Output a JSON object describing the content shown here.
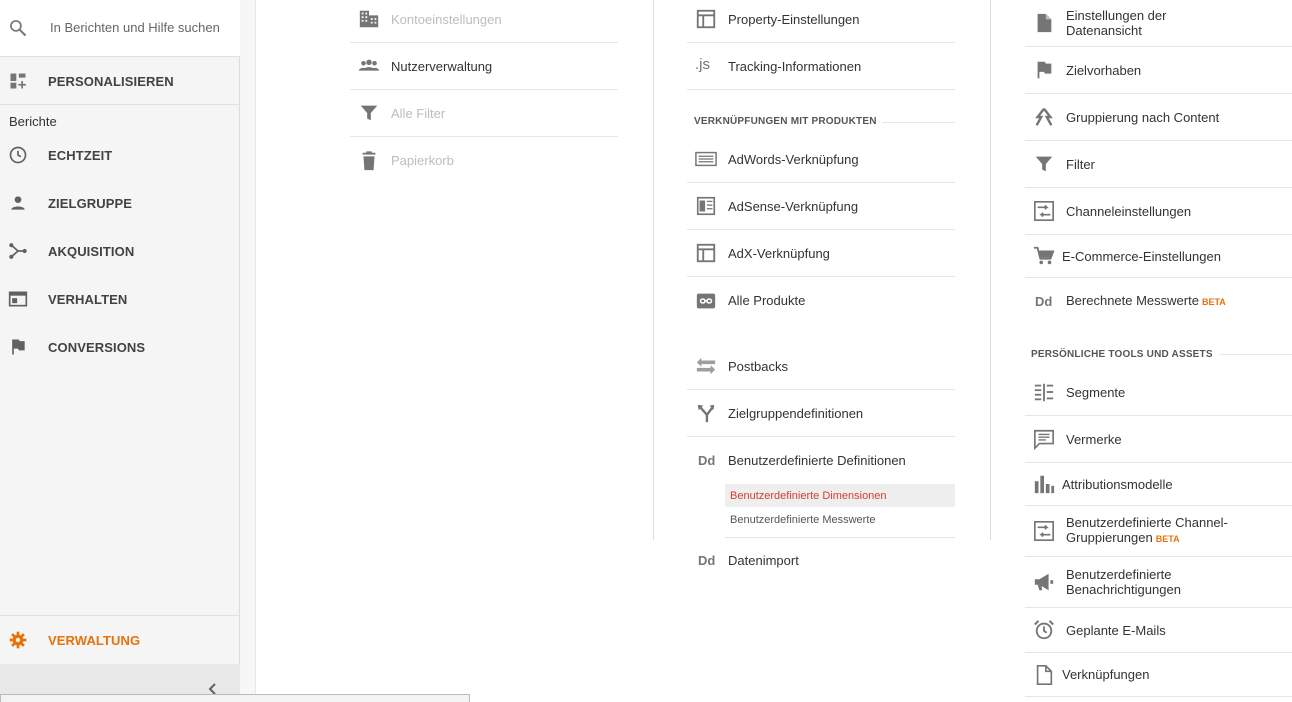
{
  "search": {
    "placeholder": "In Berichten und Hilfe suchen"
  },
  "sidebar": {
    "customize": "PERSONALISIEREN",
    "section_label": "Berichte",
    "items": [
      {
        "label": "ECHTZEIT",
        "icon": "clock-icon"
      },
      {
        "label": "ZIELGRUPPE",
        "icon": "person-icon"
      },
      {
        "label": "AKQUISITION",
        "icon": "acquisition-icon"
      },
      {
        "label": "VERHALTEN",
        "icon": "behavior-icon"
      },
      {
        "label": "CONVERSIONS",
        "icon": "flag-icon"
      }
    ],
    "admin": "VERWALTUNG",
    "accent_color": "#e8710a"
  },
  "account_column": {
    "items": [
      {
        "label": "Kontoeinstellungen",
        "icon": "building-icon",
        "disabled": true
      },
      {
        "label": "Nutzerverwaltung",
        "icon": "users-icon",
        "disabled": false
      },
      {
        "label": "Alle Filter",
        "icon": "filter-icon",
        "disabled": true
      },
      {
        "label": "Papierkorb",
        "icon": "trash-icon",
        "disabled": true
      }
    ]
  },
  "property_column": {
    "items_top": [
      {
        "label": "Property-Einstellungen",
        "icon": "property-icon"
      },
      {
        "label": "Tracking-Informationen",
        "icon": "js-icon",
        "glyph": ".js"
      }
    ],
    "products_heading": "VERKNÜPFUNGEN MIT PRODUKTEN",
    "product_links": [
      {
        "label": "AdWords-Verknüpfung",
        "icon": "adwords-icon"
      },
      {
        "label": "AdSense-Verknüpfung",
        "icon": "adsense-icon"
      },
      {
        "label": "AdX-Verknüpfung",
        "icon": "adx-icon"
      },
      {
        "label": "Alle Produkte",
        "icon": "link-icon"
      }
    ],
    "items_bottom": [
      {
        "label": "Postbacks",
        "icon": "postbacks-icon"
      },
      {
        "label": "Zielgruppendefinitionen",
        "icon": "fork-icon"
      },
      {
        "label": "Benutzerdefinierte Definitionen",
        "icon": "dd-icon",
        "glyph": "Dd"
      }
    ],
    "sub_items": [
      {
        "label": "Benutzerdefinierte Dimensionen",
        "active": true
      },
      {
        "label": "Benutzerdefinierte Messwerte",
        "active": false
      }
    ],
    "data_import": {
      "label": "Datenimport",
      "glyph": "Dd"
    }
  },
  "view_column": {
    "items": [
      {
        "label": "Einstellungen der Datenansicht",
        "icon": "doc-icon"
      },
      {
        "label": "Zielvorhaben",
        "icon": "flag-icon"
      },
      {
        "label": "Gruppierung nach Content",
        "icon": "grouping-icon"
      },
      {
        "label": "Filter",
        "icon": "filter-icon"
      },
      {
        "label": "Channeleinstellungen",
        "icon": "channel-icon"
      },
      {
        "label": "E-Commerce-Einstellungen",
        "icon": "cart-icon"
      },
      {
        "label": "Berechnete Messwerte",
        "icon": "dd-icon",
        "glyph": "Dd",
        "badge": "BETA"
      }
    ],
    "tools_heading": "PERSÖNLICHE TOOLS UND ASSETS",
    "tools": [
      {
        "label": "Segmente",
        "icon": "segments-icon"
      },
      {
        "label": "Vermerke",
        "icon": "comment-icon"
      },
      {
        "label": "Attributionsmodelle",
        "icon": "bars-icon"
      },
      {
        "label": "Benutzerdefinierte Channel-Gruppierungen",
        "icon": "channel-icon",
        "badge": "BETA"
      },
      {
        "label": "Benutzerdefinierte Benachrichtigungen",
        "icon": "megaphone-icon"
      },
      {
        "label": "Geplante E-Mails",
        "icon": "alarm-icon"
      },
      {
        "label": "Verknüpfungen",
        "icon": "page-icon"
      }
    ]
  }
}
